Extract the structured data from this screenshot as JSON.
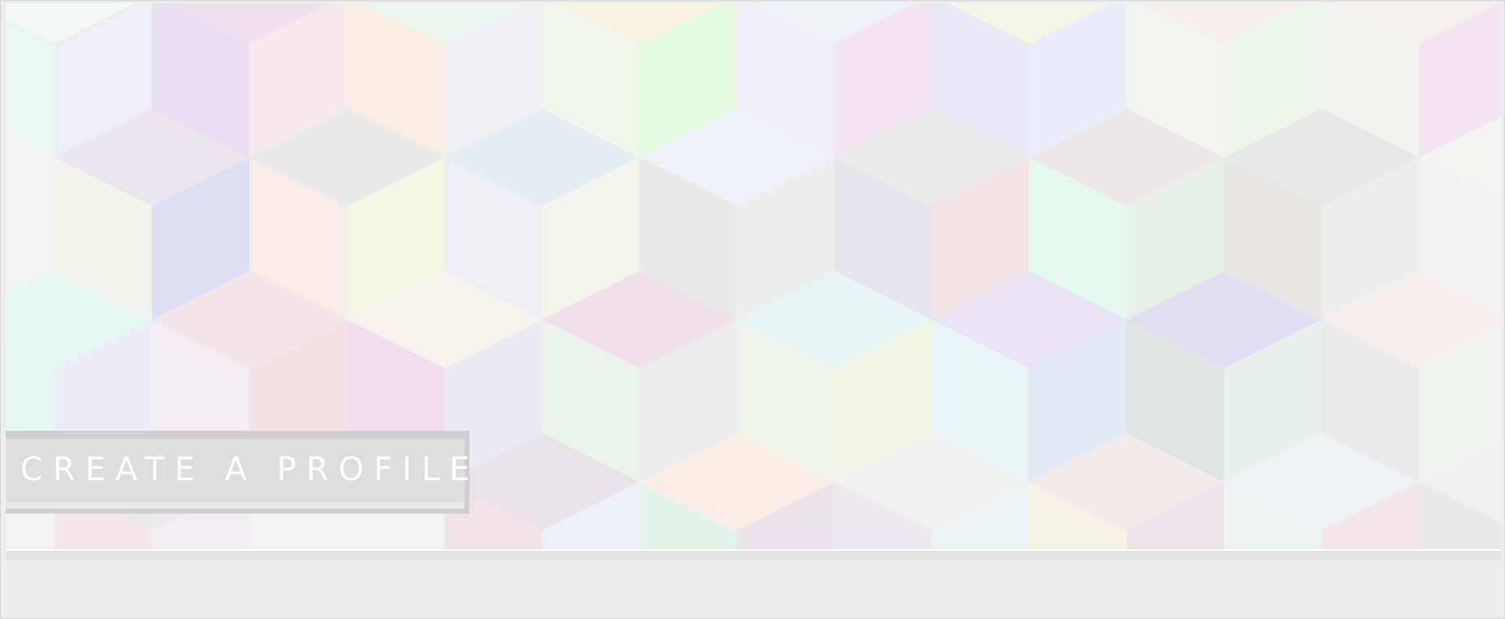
{
  "hero": {
    "background_pattern": "pastel-isometric-cubes",
    "colors": [
      "#f4dfe8",
      "#e4e6f7",
      "#dff3ea",
      "#f6efd9",
      "#e3f2e2",
      "#ecdff4",
      "#dfeaf5",
      "#f7e7e0",
      "#e6e6e6"
    ]
  },
  "profile_button": {
    "label": "CREATE A PROFILE"
  }
}
